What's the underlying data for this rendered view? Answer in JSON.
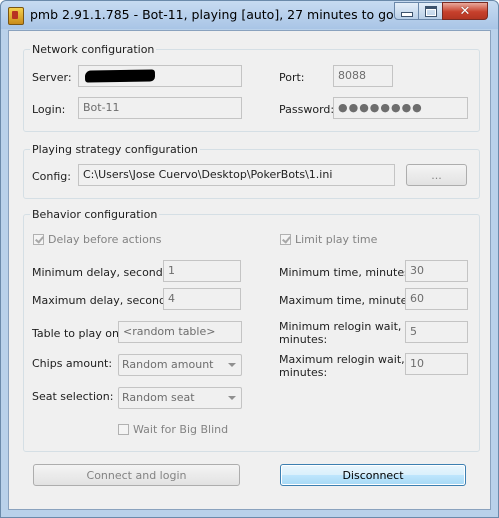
{
  "window": {
    "title": "pmb 2.91.1.785 - Bot-11, playing [auto], 27 minutes to go",
    "close_glyph": "✕"
  },
  "network": {
    "title": "Network configuration",
    "server_label": "Server:",
    "port_label": "Port:",
    "port_value": "8088",
    "login_label": "Login:",
    "login_value": "Bot-11",
    "password_label": "Password:",
    "password_mask": "●●●●●●●●"
  },
  "strategy": {
    "title": "Playing strategy configuration",
    "config_label": "Config:",
    "config_value": "C:\\Users\\Jose Cuervo\\Desktop\\PokerBots\\1.ini",
    "browse_label": "..."
  },
  "behavior": {
    "title": "Behavior configuration",
    "delay_check_label": "Delay before actions",
    "limit_check_label": "Limit play time",
    "min_delay_label": "Minimum delay, seconds:",
    "min_delay_value": "1",
    "max_delay_label": "Maximum delay, seconds:",
    "max_delay_value": "4",
    "min_time_label": "Minimum time, minutes:",
    "min_time_value": "30",
    "max_time_label": "Maximum time, minutes:",
    "max_time_value": "60",
    "table_label": "Table to play on:",
    "table_value": "<random table>",
    "min_relogin_label_1": "Minimum relogin wait,",
    "min_relogin_label_2": "minutes:",
    "min_relogin_value": "5",
    "max_relogin_label_1": "Maximum relogin wait,",
    "max_relogin_label_2": "minutes:",
    "max_relogin_value": "10",
    "chips_label": "Chips amount:",
    "chips_value": "Random amount",
    "seat_label": "Seat selection:",
    "seat_value": "Random seat",
    "bigblind_label": "Wait for Big Blind"
  },
  "actions": {
    "connect_label": "Connect and login",
    "disconnect_label": "Disconnect"
  }
}
